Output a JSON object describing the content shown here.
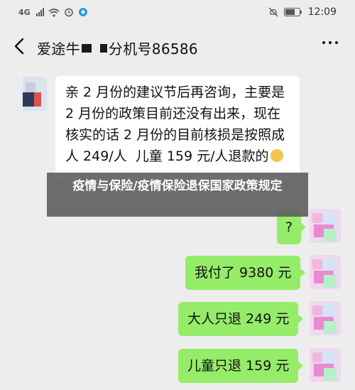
{
  "status_bar": {
    "network": "4G",
    "time": "12:09",
    "icons": [
      "signal-icon",
      "wifi-icon",
      "alarm-icon",
      "app-icon",
      "mute-icon",
      "battery-icon"
    ]
  },
  "header": {
    "title_prefix": "爱途牛",
    "title_suffix": "分机号86586",
    "back_icon": "back-icon",
    "more_icon": "more-icon"
  },
  "messages": [
    {
      "side": "left",
      "text": "亲 2 月份的建议节后再咨询，主要是 2 月份的政策目前还没有出来，现在核实的话 2 月份的目前核损是按照成人 249/人  儿童 159 元/人退款的"
    },
    {
      "side": "right",
      "text": "?"
    },
    {
      "side": "right",
      "text": "我付了 9380 元"
    },
    {
      "side": "right",
      "text": "大人只退 249 元"
    },
    {
      "side": "right",
      "text": "儿童只退 159 元"
    }
  ],
  "overlay": {
    "text": "疫情与保险/疫情保险退保国家政策规定"
  },
  "colors": {
    "background": "#ededed",
    "bubble_self": "#95ec69",
    "bubble_other": "#ffffff",
    "overlay": "#5a5a5a"
  }
}
